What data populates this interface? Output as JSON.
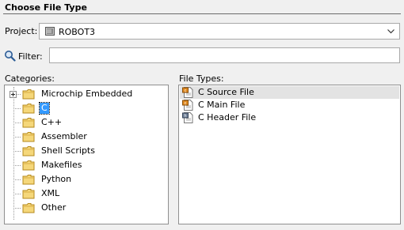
{
  "dialog": {
    "title": "Choose File Type"
  },
  "project": {
    "label": "Project:",
    "value": "ROBOT3"
  },
  "filter": {
    "label": "Filter:",
    "value": "",
    "placeholder": ""
  },
  "categories": {
    "label": "Categories:",
    "items": [
      {
        "label": "Microchip Embedded",
        "expandable": true
      },
      {
        "label": "C",
        "selected": true
      },
      {
        "label": "C++"
      },
      {
        "label": "Assembler"
      },
      {
        "label": "Shell Scripts"
      },
      {
        "label": "Makefiles"
      },
      {
        "label": "Python"
      },
      {
        "label": "XML"
      },
      {
        "label": "Other"
      }
    ]
  },
  "file_types": {
    "label": "File Types:",
    "items": [
      {
        "label": "C Source File",
        "icon": "c-source-file-icon",
        "highlighted": true
      },
      {
        "label": "C Main File",
        "icon": "c-main-file-icon"
      },
      {
        "label": "C Header File",
        "icon": "c-header-file-icon"
      }
    ]
  },
  "colors": {
    "selection": "#3399ff",
    "hover_row": "#e3e3e3",
    "folder": "#f5d77a"
  }
}
